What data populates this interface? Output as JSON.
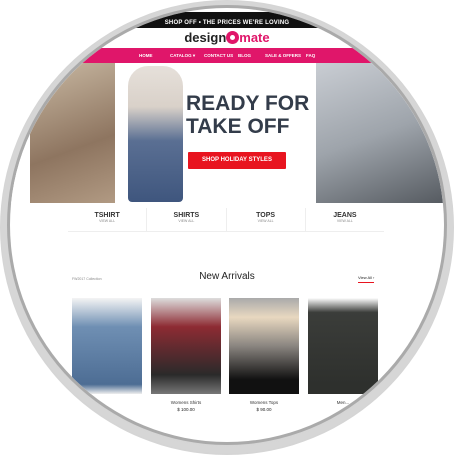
{
  "topbar": {
    "text": "SHOP OFF • THE PRICES WE'RE LOVING"
  },
  "logo": {
    "part1": "design",
    "part2": "mate"
  },
  "nav": {
    "items": [
      "HOME",
      "CATALOG ▾",
      "CONTACT US",
      "BLOG",
      "SALE & OFFERS",
      "FAQ"
    ]
  },
  "hero": {
    "headline_line1": "READY FOR",
    "headline_line2": "TAKE OFF",
    "cta": "SHOP HOLIDAY STYLES"
  },
  "categories": [
    {
      "title": "TSHIRT",
      "sub": "VIEW ALL"
    },
    {
      "title": "SHIRTS",
      "sub": "VIEW ALL"
    },
    {
      "title": "TOPS",
      "sub": "VIEW ALL"
    },
    {
      "title": "JEANS",
      "sub": "VIEW ALL"
    }
  ],
  "arrivals": {
    "collection": "FW2017 Collection",
    "title": "New Arrivals",
    "view_all": "View All ›"
  },
  "products": [
    {
      "name": "",
      "price": "",
      "color": "#6f8fb3"
    },
    {
      "name": "Womens Shirts",
      "price": "$ 100.00",
      "color": "#8d2b33"
    },
    {
      "name": "Womens Tops",
      "price": "$ 90.00",
      "color": "#8a8580"
    },
    {
      "name": "Men...",
      "price": "",
      "color": "#3b3d3a"
    }
  ],
  "colors": {
    "brand": "#e0166a",
    "cta": "#e8141f"
  }
}
